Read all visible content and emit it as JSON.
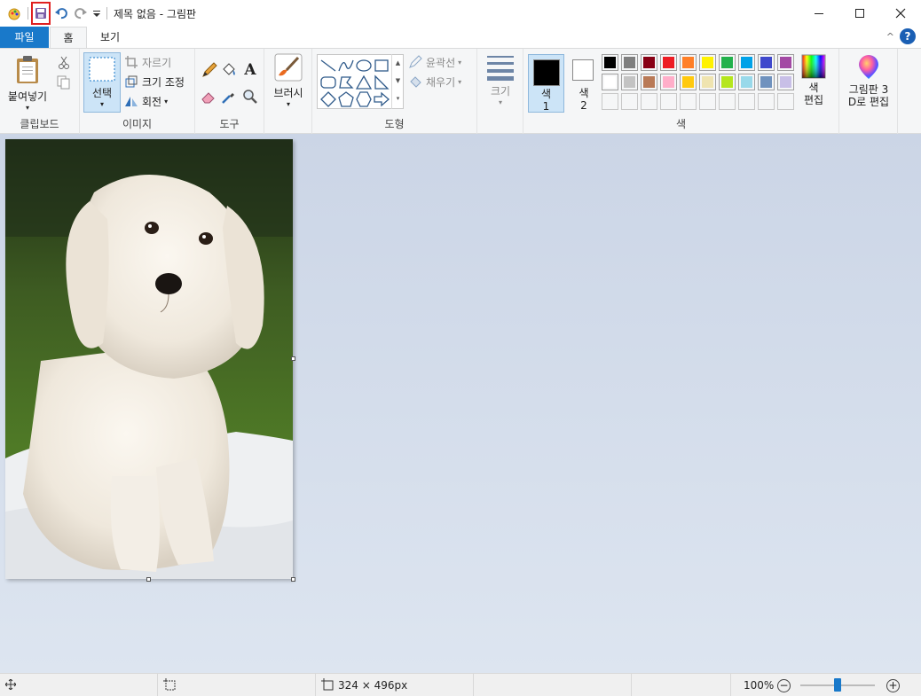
{
  "window": {
    "title": "제목 없음 - 그림판",
    "minimize_icon": "minimize-icon",
    "maximize_icon": "maximize-icon",
    "close_icon": "close-icon"
  },
  "quick_access": [
    "app-icon",
    "save-icon",
    "undo-icon",
    "redo-icon",
    "customize-dropdown-icon"
  ],
  "tabs": [
    {
      "label": "파일"
    },
    {
      "label": "홈"
    },
    {
      "label": "보기"
    }
  ],
  "ribbon": {
    "clipboard": {
      "group_label": "클립보드",
      "paste_label": "붙여넣기",
      "cut_icon": "scissors-icon",
      "copy_icon": "copy-icon"
    },
    "image": {
      "group_label": "이미지",
      "select_label": "선택",
      "crop_label": "자르기",
      "resize_label": "크기 조정",
      "rotate_label": "회전"
    },
    "tools": {
      "group_label": "도구",
      "text_glyph": "A"
    },
    "brushes": {
      "label": "브러시"
    },
    "shapes": {
      "group_label": "도형",
      "outline_label": "윤곽선",
      "fill_label": "채우기"
    },
    "size": {
      "label": "크기"
    },
    "colors": {
      "group_label": "색",
      "color1_label": "색",
      "color1_num": "1",
      "color2_label": "색",
      "color2_num": "2",
      "edit_label_1": "색",
      "edit_label_2": "편집",
      "palette_row1": [
        "#000000",
        "#7f7f7f",
        "#880015",
        "#ed1c24",
        "#ff7f27",
        "#fff200",
        "#22b14c",
        "#00a2e8",
        "#3f48cc",
        "#a349a4"
      ],
      "palette_row2": [
        "#ffffff",
        "#c3c3c3",
        "#b97a57",
        "#ffaec9",
        "#ffc90e",
        "#efe4b0",
        "#b5e61d",
        "#99d9ea",
        "#7092be",
        "#c8bfe7"
      ],
      "palette_row3": [
        "#ffffff",
        "#ffffff",
        "#ffffff",
        "#ffffff",
        "#ffffff",
        "#ffffff",
        "#ffffff",
        "#ffffff",
        "#ffffff",
        "#ffffff"
      ]
    },
    "paint3d": {
      "label_1": "그림판 3",
      "label_2": "D로 편집"
    }
  },
  "status": {
    "image_size": "324 × 496px",
    "zoom": "100%",
    "zoom_level": 0.5
  }
}
